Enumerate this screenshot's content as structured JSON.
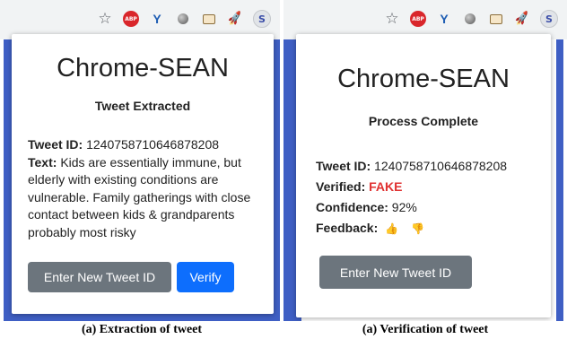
{
  "left": {
    "app_title": "Chrome-SEAN",
    "status": "Tweet Extracted",
    "tweet_id_label": "Tweet ID:",
    "tweet_id_value": "1240758710646878208",
    "text_label": "Text:",
    "text_value": "Kids are essentially immune, but elderly with existing conditions are vulnerable. Family gatherings with close contact between kids & grandparents probably most risky",
    "enter_button": "Enter New Tweet ID",
    "verify_button": "Verify",
    "caption": "(a) Extraction of tweet"
  },
  "right": {
    "app_title": "Chrome-SEAN",
    "status": "Process Complete",
    "tweet_id_label": "Tweet ID:",
    "tweet_id_value": "1240758710646878208",
    "verified_label": "Verified:",
    "verified_value": "FAKE",
    "confidence_label": "Confidence:",
    "confidence_value": "92%",
    "feedback_label": "Feedback:",
    "enter_button": "Enter New Tweet ID",
    "caption": "(a) Verification of tweet"
  },
  "toolbar": {
    "icons": [
      "bookmark-star-icon",
      "adblock-plus-icon",
      "vee-extension-icon",
      "circle-extension-icon",
      "card-extension-icon",
      "rocket-extension-icon",
      "chrome-sean-extension-icon"
    ],
    "abp_text": "ABP",
    "sean_text": "S"
  },
  "colors": {
    "page_blue": "#3f5fc4",
    "button_gray": "#6c757d",
    "button_blue": "#0d6efd",
    "fake_red": "#e03131",
    "thumb_up_green": "#2f9e44"
  }
}
